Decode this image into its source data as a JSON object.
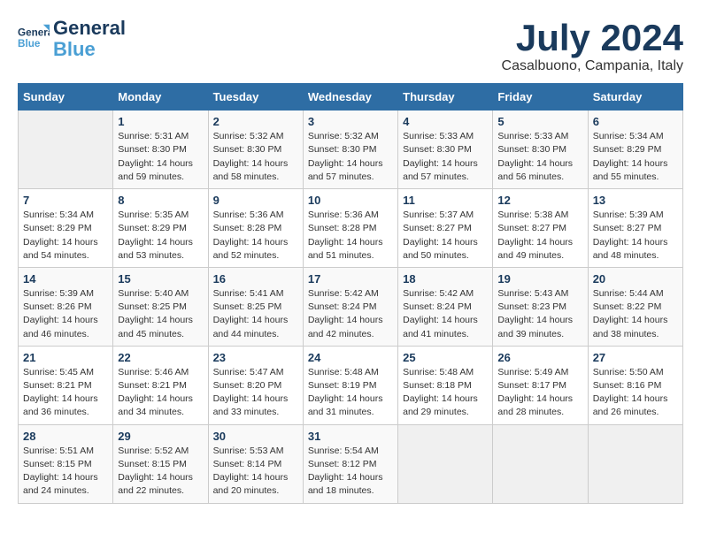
{
  "logo": {
    "line1": "General",
    "line2": "Blue"
  },
  "title": "July 2024",
  "location": "Casalbuono, Campania, Italy",
  "days_header": [
    "Sunday",
    "Monday",
    "Tuesday",
    "Wednesday",
    "Thursday",
    "Friday",
    "Saturday"
  ],
  "weeks": [
    [
      {
        "day": "",
        "info": ""
      },
      {
        "day": "1",
        "info": "Sunrise: 5:31 AM\nSunset: 8:30 PM\nDaylight: 14 hours\nand 59 minutes."
      },
      {
        "day": "2",
        "info": "Sunrise: 5:32 AM\nSunset: 8:30 PM\nDaylight: 14 hours\nand 58 minutes."
      },
      {
        "day": "3",
        "info": "Sunrise: 5:32 AM\nSunset: 8:30 PM\nDaylight: 14 hours\nand 57 minutes."
      },
      {
        "day": "4",
        "info": "Sunrise: 5:33 AM\nSunset: 8:30 PM\nDaylight: 14 hours\nand 57 minutes."
      },
      {
        "day": "5",
        "info": "Sunrise: 5:33 AM\nSunset: 8:30 PM\nDaylight: 14 hours\nand 56 minutes."
      },
      {
        "day": "6",
        "info": "Sunrise: 5:34 AM\nSunset: 8:29 PM\nDaylight: 14 hours\nand 55 minutes."
      }
    ],
    [
      {
        "day": "7",
        "info": "Sunrise: 5:34 AM\nSunset: 8:29 PM\nDaylight: 14 hours\nand 54 minutes."
      },
      {
        "day": "8",
        "info": "Sunrise: 5:35 AM\nSunset: 8:29 PM\nDaylight: 14 hours\nand 53 minutes."
      },
      {
        "day": "9",
        "info": "Sunrise: 5:36 AM\nSunset: 8:28 PM\nDaylight: 14 hours\nand 52 minutes."
      },
      {
        "day": "10",
        "info": "Sunrise: 5:36 AM\nSunset: 8:28 PM\nDaylight: 14 hours\nand 51 minutes."
      },
      {
        "day": "11",
        "info": "Sunrise: 5:37 AM\nSunset: 8:27 PM\nDaylight: 14 hours\nand 50 minutes."
      },
      {
        "day": "12",
        "info": "Sunrise: 5:38 AM\nSunset: 8:27 PM\nDaylight: 14 hours\nand 49 minutes."
      },
      {
        "day": "13",
        "info": "Sunrise: 5:39 AM\nSunset: 8:27 PM\nDaylight: 14 hours\nand 48 minutes."
      }
    ],
    [
      {
        "day": "14",
        "info": "Sunrise: 5:39 AM\nSunset: 8:26 PM\nDaylight: 14 hours\nand 46 minutes."
      },
      {
        "day": "15",
        "info": "Sunrise: 5:40 AM\nSunset: 8:25 PM\nDaylight: 14 hours\nand 45 minutes."
      },
      {
        "day": "16",
        "info": "Sunrise: 5:41 AM\nSunset: 8:25 PM\nDaylight: 14 hours\nand 44 minutes."
      },
      {
        "day": "17",
        "info": "Sunrise: 5:42 AM\nSunset: 8:24 PM\nDaylight: 14 hours\nand 42 minutes."
      },
      {
        "day": "18",
        "info": "Sunrise: 5:42 AM\nSunset: 8:24 PM\nDaylight: 14 hours\nand 41 minutes."
      },
      {
        "day": "19",
        "info": "Sunrise: 5:43 AM\nSunset: 8:23 PM\nDaylight: 14 hours\nand 39 minutes."
      },
      {
        "day": "20",
        "info": "Sunrise: 5:44 AM\nSunset: 8:22 PM\nDaylight: 14 hours\nand 38 minutes."
      }
    ],
    [
      {
        "day": "21",
        "info": "Sunrise: 5:45 AM\nSunset: 8:21 PM\nDaylight: 14 hours\nand 36 minutes."
      },
      {
        "day": "22",
        "info": "Sunrise: 5:46 AM\nSunset: 8:21 PM\nDaylight: 14 hours\nand 34 minutes."
      },
      {
        "day": "23",
        "info": "Sunrise: 5:47 AM\nSunset: 8:20 PM\nDaylight: 14 hours\nand 33 minutes."
      },
      {
        "day": "24",
        "info": "Sunrise: 5:48 AM\nSunset: 8:19 PM\nDaylight: 14 hours\nand 31 minutes."
      },
      {
        "day": "25",
        "info": "Sunrise: 5:48 AM\nSunset: 8:18 PM\nDaylight: 14 hours\nand 29 minutes."
      },
      {
        "day": "26",
        "info": "Sunrise: 5:49 AM\nSunset: 8:17 PM\nDaylight: 14 hours\nand 28 minutes."
      },
      {
        "day": "27",
        "info": "Sunrise: 5:50 AM\nSunset: 8:16 PM\nDaylight: 14 hours\nand 26 minutes."
      }
    ],
    [
      {
        "day": "28",
        "info": "Sunrise: 5:51 AM\nSunset: 8:15 PM\nDaylight: 14 hours\nand 24 minutes."
      },
      {
        "day": "29",
        "info": "Sunrise: 5:52 AM\nSunset: 8:15 PM\nDaylight: 14 hours\nand 22 minutes."
      },
      {
        "day": "30",
        "info": "Sunrise: 5:53 AM\nSunset: 8:14 PM\nDaylight: 14 hours\nand 20 minutes."
      },
      {
        "day": "31",
        "info": "Sunrise: 5:54 AM\nSunset: 8:12 PM\nDaylight: 14 hours\nand 18 minutes."
      },
      {
        "day": "",
        "info": ""
      },
      {
        "day": "",
        "info": ""
      },
      {
        "day": "",
        "info": ""
      }
    ]
  ]
}
